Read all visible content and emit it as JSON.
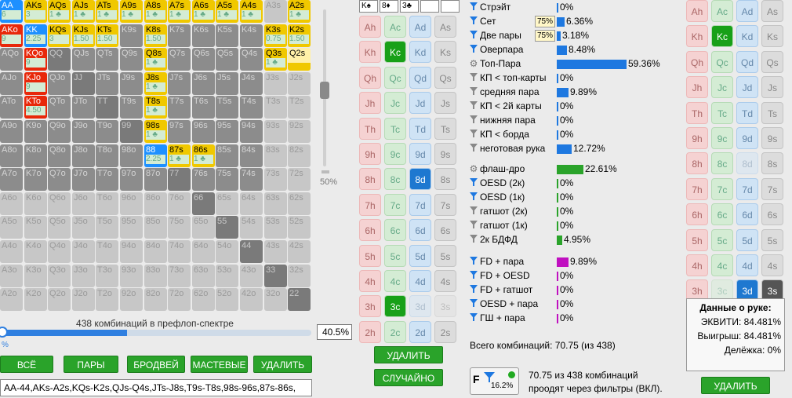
{
  "range_grid": {
    "ranks": [
      "A",
      "K",
      "Q",
      "J",
      "T",
      "9",
      "8",
      "7",
      "6",
      "5",
      "4",
      "3",
      "2"
    ],
    "selected": [
      {
        "label": "AA",
        "count": "6",
        "style": "blue",
        "fill": 100
      },
      {
        "label": "AKs",
        "count": "3",
        "style": "yellow",
        "fill": 100
      },
      {
        "label": "AQs",
        "count": "1 ♣",
        "style": "yellow",
        "fill": 100
      },
      {
        "label": "AJs",
        "count": "1 ♣",
        "style": "yellow",
        "fill": 100
      },
      {
        "label": "ATs",
        "count": "1 ♣",
        "style": "yellow",
        "fill": 100
      },
      {
        "label": "A9s",
        "count": "1 ♣",
        "style": "yellow",
        "fill": 100
      },
      {
        "label": "A8s",
        "count": "1 ♣",
        "style": "yellow",
        "fill": 100
      },
      {
        "label": "A7s",
        "count": "1 ♣",
        "style": "yellow",
        "fill": 100
      },
      {
        "label": "A6s",
        "count": "1 ♣",
        "style": "yellow",
        "fill": 100
      },
      {
        "label": "A5s",
        "count": "1 ♣",
        "style": "yellow",
        "fill": 100
      },
      {
        "label": "A4s",
        "count": "1 ♣",
        "style": "yellow",
        "fill": 100
      },
      {
        "label": "A2s",
        "count": "1 ♣",
        "style": "yellow",
        "fill": 100
      },
      {
        "label": "AKo",
        "count": "9",
        "style": "red",
        "fill": 100
      },
      {
        "label": "KK",
        "count": "2.25",
        "style": "blue",
        "fill": 100
      },
      {
        "label": "KQs",
        "count": "3",
        "style": "yellow",
        "fill": 100
      },
      {
        "label": "KJs",
        "count": "1.50",
        "style": "yellow",
        "fill": 100
      },
      {
        "label": "KTs",
        "count": "1.50",
        "style": "yellow",
        "fill": 100
      },
      {
        "label": "K8s",
        "count": "1.50",
        "style": "yellow",
        "fill": 100
      },
      {
        "label": "K3s",
        "count": "0.75",
        "style": "yellow",
        "fill": 100
      },
      {
        "label": "K2s",
        "count": "1.50",
        "style": "yellow",
        "fill": 100
      },
      {
        "label": "KQo",
        "count": "9",
        "style": "red",
        "fill": 100
      },
      {
        "label": "Q8s",
        "count": "1 ♣",
        "style": "yellow",
        "fill": 100
      },
      {
        "label": "Q3s",
        "count": "1 ♣",
        "style": "yellow",
        "fill": 100
      },
      {
        "label": "Q2s",
        "count": "",
        "style": "yellow",
        "fill": 35
      },
      {
        "label": "KJo",
        "count": "9",
        "style": "red",
        "fill": 100
      },
      {
        "label": "J8s",
        "count": "1 ♣",
        "style": "yellow",
        "fill": 100
      },
      {
        "label": "KTo",
        "count": "4.50",
        "style": "red",
        "fill": 100
      },
      {
        "label": "T8s",
        "count": "1 ♣",
        "style": "yellow",
        "fill": 100
      },
      {
        "label": "98s",
        "count": "1 ♣",
        "style": "yellow",
        "fill": 100
      },
      {
        "label": "88",
        "count": "2.25",
        "style": "blue",
        "fill": 100
      },
      {
        "label": "87s",
        "count": "1 ♣",
        "style": "yellow",
        "fill": 100
      },
      {
        "label": "86s",
        "count": "1 ♣",
        "style": "yellow",
        "fill": 100
      }
    ]
  },
  "left": {
    "slider_pct": "50%",
    "slider_level": 50,
    "combos_caption": "438 комбинаций в префлоп-спектре",
    "range_pct": "40.5%",
    "range_level": 40.5,
    "range_zero": "%",
    "buttons": [
      "ВСЁ",
      "ПАРЫ",
      "БРОДВЕЙ",
      "МАСТЕВЫЕ",
      "УДАЛИТЬ"
    ],
    "combo_text": "AA-44,AKs-A2s,KQs-K2s,QJs-Q4s,JTs-J8s,T9s-T8s,98s-96s,87s-86s,"
  },
  "board": {
    "slots": [
      "K♠",
      "8♦",
      "3♣",
      "",
      ""
    ],
    "ranks": [
      "A",
      "K",
      "Q",
      "J",
      "T",
      "9",
      "8",
      "7",
      "6",
      "5",
      "4",
      "3",
      "2"
    ],
    "suits": [
      "h",
      "c",
      "d",
      "s"
    ],
    "selected": [
      "Kc",
      "8d",
      "3c"
    ],
    "used": [
      "3d",
      "3s"
    ],
    "delete": "УДАЛИТЬ",
    "random": "СЛУЧАЙНО"
  },
  "stats": {
    "group1": [
      {
        "label": "Стрэйт",
        "val": "0%",
        "pct": 0,
        "icon": "funnel",
        "color": "#1e78e0"
      },
      {
        "label": "Сет",
        "val": "6.36%",
        "pct": 6.36,
        "icon": "funnel",
        "color": "#1e78e0",
        "tag": "75%"
      },
      {
        "label": "Две пары",
        "val": "3.18%",
        "pct": 3.18,
        "icon": "funnel",
        "color": "#1e78e0",
        "tag": "75%"
      },
      {
        "label": "Оверпара",
        "val": "8.48%",
        "pct": 8.48,
        "icon": "funnel",
        "color": "#1e78e0"
      },
      {
        "label": "Топ-Пара",
        "val": "59.36%",
        "pct": 59.36,
        "icon": "gear",
        "color": "#1e78e0"
      },
      {
        "label": "КП < топ-карты",
        "val": "0%",
        "pct": 0,
        "icon": "funnel-gray",
        "color": "#1e78e0"
      },
      {
        "label": "средняя пара",
        "val": "9.89%",
        "pct": 9.89,
        "icon": "funnel-gray",
        "color": "#1e78e0"
      },
      {
        "label": "КП < 2й карты",
        "val": "0%",
        "pct": 0,
        "icon": "funnel-gray",
        "color": "#1e78e0"
      },
      {
        "label": "нижняя пара",
        "val": "0%",
        "pct": 0,
        "icon": "funnel-gray",
        "color": "#1e78e0"
      },
      {
        "label": "КП < борда",
        "val": "0%",
        "pct": 0,
        "icon": "funnel-gray",
        "color": "#1e78e0"
      },
      {
        "label": "неготовая рука",
        "val": "12.72%",
        "pct": 12.72,
        "icon": "funnel-gray",
        "color": "#1e78e0"
      }
    ],
    "group2": [
      {
        "label": "флаш-дро",
        "val": "22.61%",
        "pct": 22.61,
        "icon": "gear",
        "color": "#2aa32a"
      },
      {
        "label": "OESD (2к)",
        "val": "0%",
        "pct": 0,
        "icon": "funnel",
        "color": "#2aa32a"
      },
      {
        "label": "OESD (1к)",
        "val": "0%",
        "pct": 0,
        "icon": "funnel",
        "color": "#2aa32a"
      },
      {
        "label": "гатшот (2к)",
        "val": "0%",
        "pct": 0,
        "icon": "funnel-gray",
        "color": "#2aa32a"
      },
      {
        "label": "гатшот (1к)",
        "val": "0%",
        "pct": 0,
        "icon": "funnel-gray",
        "color": "#2aa32a"
      },
      {
        "label": "2к БДФД",
        "val": "4.95%",
        "pct": 4.95,
        "icon": "funnel-gray",
        "color": "#2aa32a"
      }
    ],
    "group3": [
      {
        "label": "FD + пара",
        "val": "9.89%",
        "pct": 9.89,
        "icon": "funnel",
        "color": "#c010c0"
      },
      {
        "label": "FD + OESD",
        "val": "0%",
        "pct": 0,
        "icon": "funnel",
        "color": "#c010c0"
      },
      {
        "label": "FD + гатшот",
        "val": "0%",
        "pct": 0,
        "icon": "funnel",
        "color": "#c010c0"
      },
      {
        "label": "OESD + пара",
        "val": "0%",
        "pct": 0,
        "icon": "funnel",
        "color": "#c010c0"
      },
      {
        "label": "ГШ + пара",
        "val": "0%",
        "pct": 0,
        "icon": "funnel",
        "color": "#c010c0"
      }
    ],
    "total": "Всего комбинаций: 70.75 (из 438)",
    "filter_letter": "F",
    "filter_pct": "16.2%",
    "filter_note1": "70.75 из 438 комбинаций",
    "filter_note2": "проодят через фильтры (ВКЛ)."
  },
  "hole": {
    "selected": [
      "Kc",
      "3d",
      "3s"
    ],
    "used": [
      "8d",
      "3c"
    ],
    "info_title": "Данные о руке:",
    "equity": "ЭКВИТИ: 84.481%",
    "win": "Выигрыш: 84.481%",
    "tie": "Делёжка: 0%",
    "delete": "УДАЛИТЬ"
  }
}
